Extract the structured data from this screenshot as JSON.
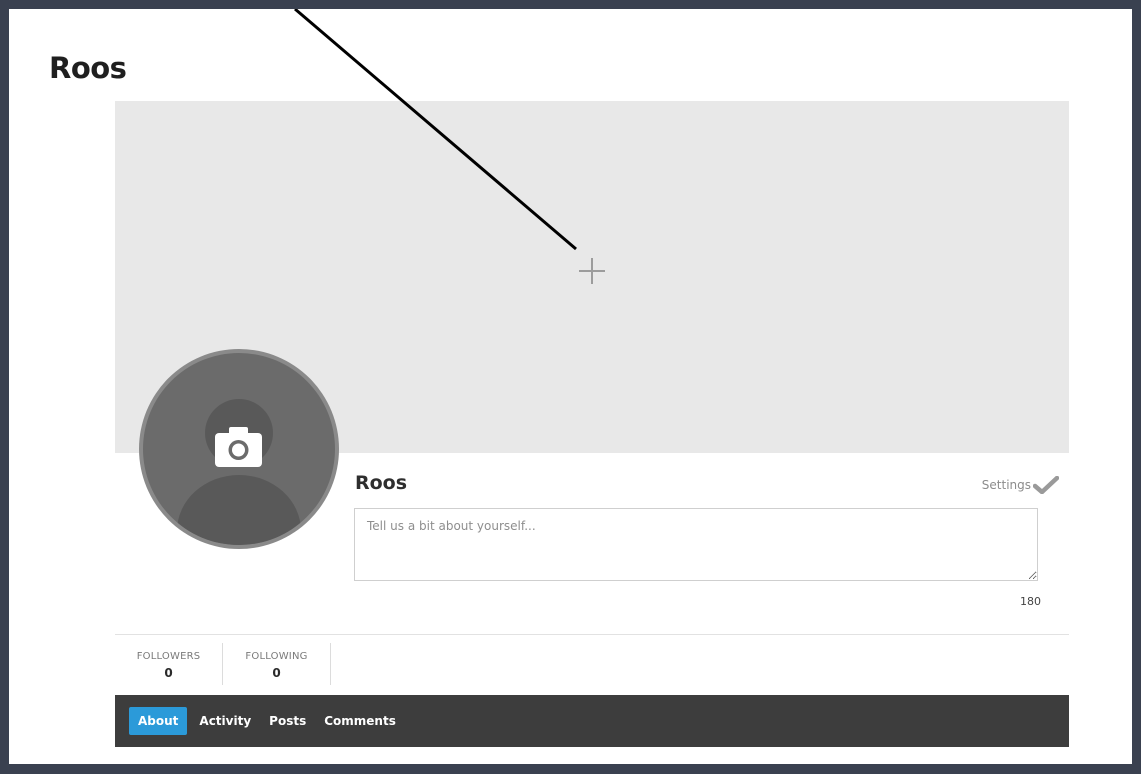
{
  "page": {
    "title": "Roos"
  },
  "cover": {
    "add_icon": "plus-icon"
  },
  "avatar": {
    "upload_icon": "camera-icon"
  },
  "profile": {
    "name": "Roos",
    "settings_label": "Settings",
    "settings_icon": "checkmark-icon",
    "bio_placeholder": "Tell us a bit about yourself...",
    "bio_value": "",
    "char_remaining": "180"
  },
  "stats": [
    {
      "label": "FOLLOWERS",
      "value": "0"
    },
    {
      "label": "FOLLOWING",
      "value": "0"
    }
  ],
  "tabs": [
    {
      "label": "About",
      "active": true
    },
    {
      "label": "Activity",
      "active": false
    },
    {
      "label": "Posts",
      "active": false
    },
    {
      "label": "Comments",
      "active": false
    }
  ],
  "colors": {
    "background": "#3a4150",
    "accent": "#2b9ad9",
    "tabbar": "#3d3d3d",
    "cover": "#e8e8e8"
  }
}
